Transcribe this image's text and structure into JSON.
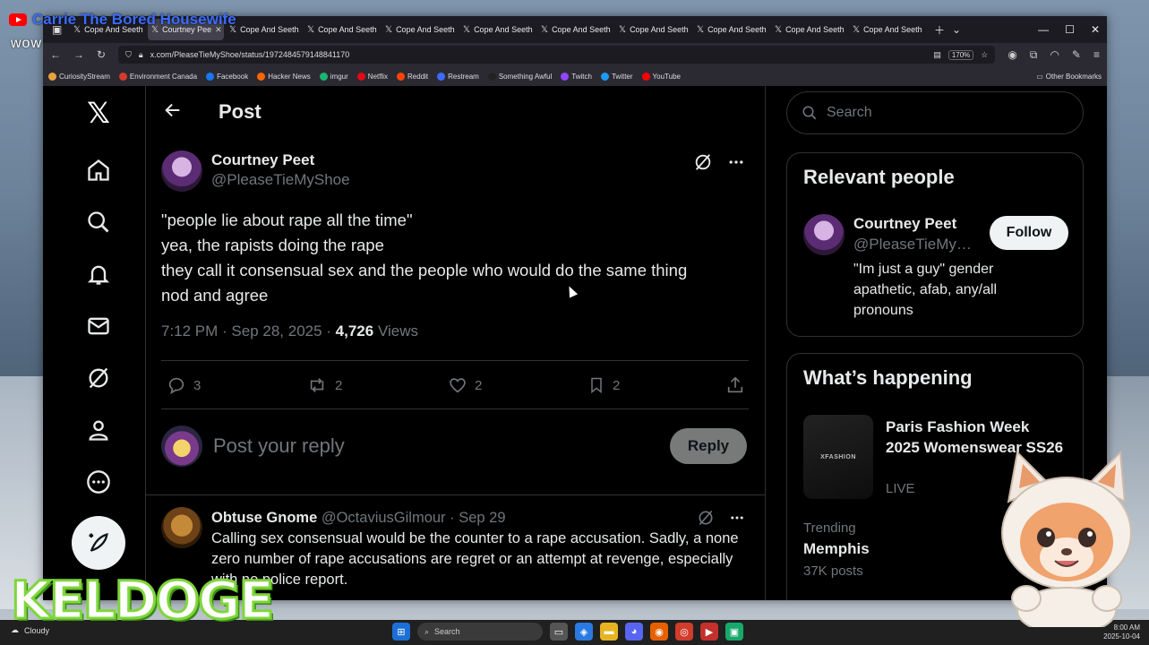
{
  "overlay": {
    "channel_name": "Carrie The Bored Housewife",
    "chat_text": "wow",
    "logo_text": "KELDOGE"
  },
  "browser": {
    "tabs": [
      {
        "label": "Cope And Seeth",
        "active": false
      },
      {
        "label": "Courtney Pee",
        "active": true
      },
      {
        "label": "Cope And Seeth",
        "active": false
      },
      {
        "label": "Cope And Seeth",
        "active": false
      },
      {
        "label": "Cope And Seeth",
        "active": false
      },
      {
        "label": "Cope And Seeth",
        "active": false
      },
      {
        "label": "Cope And Seeth",
        "active": false
      },
      {
        "label": "Cope And Seeth",
        "active": false
      },
      {
        "label": "Cope And Seeth",
        "active": false
      },
      {
        "label": "Cope And Seeth",
        "active": false
      },
      {
        "label": "Cope And Seeth",
        "active": false
      }
    ],
    "url": "x.com/PleaseTieMyShoe/status/1972484579148841170",
    "zoom": "170%",
    "bookmarks": [
      {
        "label": "CuriosityStream",
        "color": "#e8a33d"
      },
      {
        "label": "Environment Canada",
        "color": "#d63a2b"
      },
      {
        "label": "Facebook",
        "color": "#1877f2"
      },
      {
        "label": "Hacker News",
        "color": "#ff6600"
      },
      {
        "label": "imgur",
        "color": "#1bb76e"
      },
      {
        "label": "Netflix",
        "color": "#e50914"
      },
      {
        "label": "Reddit",
        "color": "#ff4500"
      },
      {
        "label": "Restream",
        "color": "#3b6cff"
      },
      {
        "label": "Something Awful",
        "color": "#222222"
      },
      {
        "label": "Twitch",
        "color": "#9146ff"
      },
      {
        "label": "Twitter",
        "color": "#1d9bf0"
      },
      {
        "label": "YouTube",
        "color": "#ff0000"
      }
    ],
    "other_bookmarks": "Other Bookmarks"
  },
  "header": {
    "title": "Post"
  },
  "post": {
    "author_name": "Courtney Peet",
    "author_handle": "@PleaseTieMyShoe",
    "lines": [
      "\"people lie about rape all the time\"",
      "yea, the rapists doing the rape",
      "they call it consensual sex and the people who would do the same thing",
      "nod and agree"
    ],
    "time": "7:12 PM · Sep 28, 2025 · ",
    "views_count": "4,726",
    "views_label": " Views",
    "replies": "3",
    "reposts": "2",
    "likes": "2",
    "bookmarks": "2"
  },
  "reply_box": {
    "placeholder": "Post your reply",
    "button": "Reply"
  },
  "comment": {
    "name": "Obtuse Gnome",
    "handle_date": " @OctaviusGilmour · Sep 29",
    "text": "Calling sex consensual would be the counter to a rape accusation. Sadly, a none zero number of rape accusations are regret or an attempt at revenge, especially with no police report."
  },
  "sidebar": {
    "search_placeholder": "Search",
    "relevant_title": "Relevant people",
    "person": {
      "name": "Courtney Peet",
      "handle": "@PleaseTieMyShoe",
      "follow": "Follow",
      "bio": "\"Im just a guy\" gender apathetic, afab, any/all pronouns"
    },
    "happening_title": "What’s happening",
    "event": {
      "thumb_text": "XFASHION",
      "title": "Paris Fashion Week 2025 Womenswear SS26",
      "status": "LIVE"
    },
    "trend": {
      "label": "Trending",
      "name": "Memphis",
      "count": "37K posts"
    }
  },
  "taskbar": {
    "weather": "Cloudy",
    "search": "Search",
    "time": "8:00 AM",
    "date": "2025-10-04"
  },
  "colors": {
    "background": "#000000",
    "text": "#e7e9ea",
    "muted": "#71767b",
    "border": "#2f3336"
  }
}
